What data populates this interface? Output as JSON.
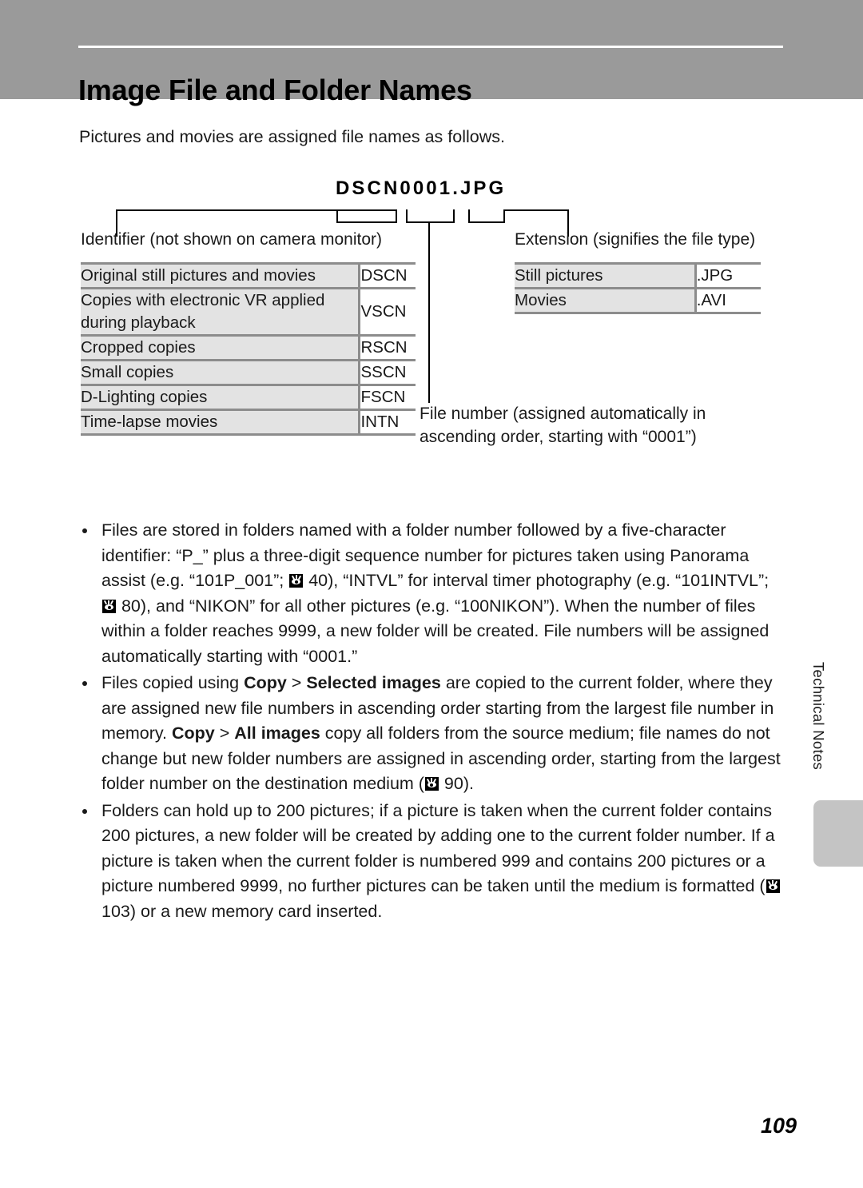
{
  "header": {
    "title": "Image File and Folder Names",
    "band_color": "#9a9a9a",
    "rule_color": "#ffffff"
  },
  "intro": "Pictures and movies are assigned file names as follows.",
  "diagram": {
    "filename": "DSCN0001.JPG",
    "identifier_label": "Identifier (not shown on camera monitor)",
    "extension_label": "Extension (signifies the file type)",
    "filenumber_label": "File number (assigned automatically in ascending order, starting with “0001”)"
  },
  "identifier_table": {
    "rows": [
      {
        "label": "Original still pictures and movies",
        "code": "DSCN"
      },
      {
        "label": "Copies with electronic VR applied during playback",
        "code": "VSCN"
      },
      {
        "label": "Cropped copies",
        "code": "RSCN"
      },
      {
        "label": "Small copies",
        "code": "SSCN"
      },
      {
        "label": "D-Lighting copies",
        "code": "FSCN"
      },
      {
        "label": "Time-lapse movies",
        "code": "INTN"
      }
    ]
  },
  "extension_table": {
    "rows": [
      {
        "label": "Still pictures",
        "code": ".JPG"
      },
      {
        "label": "Movies",
        "code": ".AVI"
      }
    ]
  },
  "bullets": [
    {
      "id": "bullet-folder-naming",
      "segments": [
        {
          "type": "text",
          "text": "Files are stored in folders named with a folder number followed by a five-character identifier: “P_” plus a three-digit sequence number for pictures taken using Panorama assist (e.g. “101P_001”; "
        },
        {
          "type": "icon",
          "icon": "page-reference-eye-icon"
        },
        {
          "type": "text",
          "text": " 40), “INTVL” for interval timer photography (e.g. “101INTVL”; "
        },
        {
          "type": "icon",
          "icon": "page-reference-eye-icon"
        },
        {
          "type": "text",
          "text": " 80), and “NIKON” for all other pictures (e.g. “100NIKON”). When the number of files within a folder reaches 9999, a new folder will be created. File numbers will be assigned automatically starting with “0001.”"
        }
      ]
    },
    {
      "id": "bullet-copy-behavior",
      "segments": [
        {
          "type": "text",
          "text": "Files copied using "
        },
        {
          "type": "bold",
          "text": "Copy"
        },
        {
          "type": "text",
          "text": " > "
        },
        {
          "type": "bold",
          "text": "Selected images"
        },
        {
          "type": "text",
          "text": " are copied to the current folder, where they are assigned new file numbers in ascending order starting from the largest file number in memory. "
        },
        {
          "type": "bold",
          "text": "Copy"
        },
        {
          "type": "text",
          "text": " > "
        },
        {
          "type": "bold",
          "text": "All images"
        },
        {
          "type": "text",
          "text": " copy all folders from the source medium; file names do not change but new folder numbers are assigned in ascending order, starting from the largest folder number on the destination medium ("
        },
        {
          "type": "icon",
          "icon": "page-reference-eye-icon"
        },
        {
          "type": "text",
          "text": " 90)."
        }
      ]
    },
    {
      "id": "bullet-folder-capacity",
      "segments": [
        {
          "type": "text",
          "text": "Folders can hold up to 200 pictures; if a picture is taken when the current folder contains 200 pictures, a new folder will be created by adding one to the current folder number. If a picture is taken when the current folder is numbered 999 and contains 200 pictures or a picture numbered 9999, no further pictures can be taken until the medium is formatted ("
        },
        {
          "type": "icon",
          "icon": "page-reference-eye-icon"
        },
        {
          "type": "text",
          "text": " 103) or a new memory card inserted."
        }
      ]
    }
  ],
  "side_tab": {
    "label": "Technical Notes",
    "block_color": "#c4c4c4"
  },
  "page_number": "109"
}
